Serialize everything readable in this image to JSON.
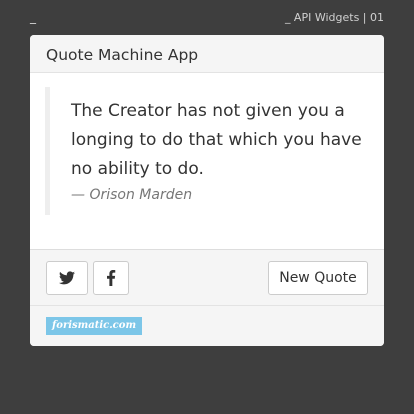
{
  "window": {
    "dash": "_",
    "title": "_ API Widgets | 01"
  },
  "app": {
    "title": "Quote Machine App"
  },
  "quote": {
    "text": "The Creator has not given you a longing to do that which you have no ability to do.",
    "author": "— Orison Marden"
  },
  "actions": {
    "twitter_icon": "twitter-icon",
    "facebook_icon": "facebook-icon",
    "new_quote_label": "New Quote"
  },
  "footer": {
    "logo_text": "forismatic.com",
    "logo_color": "#7cc6e8"
  },
  "colors": {
    "background": "#3e3e3e",
    "card": "#ffffff",
    "panel": "#f5f5f5",
    "text": "#333333",
    "author": "#777777"
  }
}
